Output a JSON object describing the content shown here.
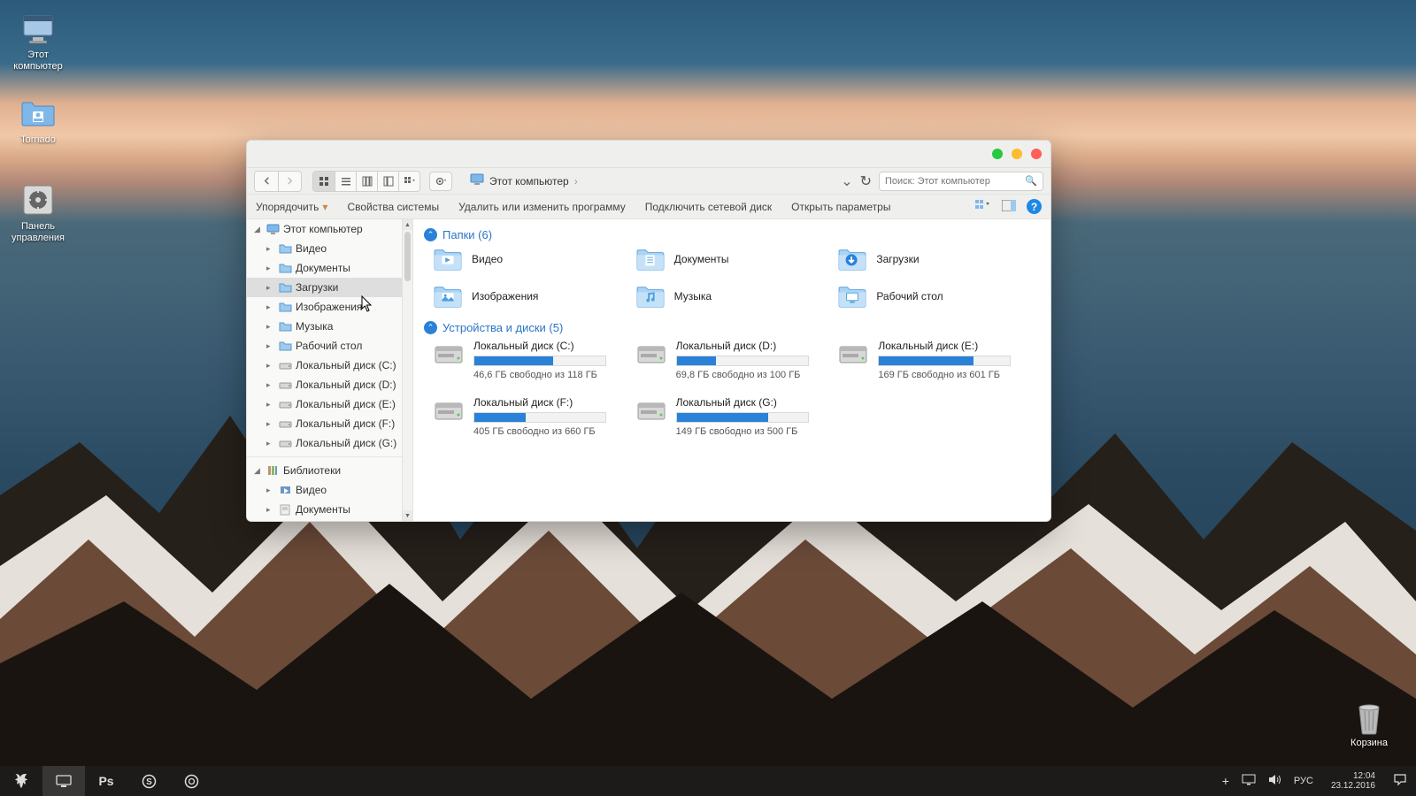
{
  "desktop": {
    "icons": [
      {
        "name": "this-pc",
        "label": "Этот\nкомпьютер"
      },
      {
        "name": "tornado",
        "label": "Tornado"
      },
      {
        "name": "control-panel",
        "label": "Панель\nуправления"
      }
    ],
    "trash_label": "Корзина"
  },
  "taskbar": {
    "lang": "РУС",
    "time": "12:04",
    "date": "23.12.2016"
  },
  "explorer": {
    "breadcrumb": {
      "location": "Этот компьютер"
    },
    "search_placeholder": "Поиск: Этот компьютер",
    "toolbar": {
      "organize": "Упорядочить",
      "system_props": "Свойства системы",
      "uninstall": "Удалить или изменить программу",
      "map_drive": "Подключить сетевой диск",
      "open_settings": "Открыть параметры"
    },
    "sidebar": {
      "root": "Этот компьютер",
      "children": [
        "Видео",
        "Документы",
        "Загрузки",
        "Изображения",
        "Музыка",
        "Рабочий стол",
        "Локальный диск (C:)",
        "Локальный диск (D:)",
        "Локальный диск (E:)",
        "Локальный диск (F:)",
        "Локальный диск (G:)"
      ],
      "libraries_header": "Библиотеки",
      "libraries": [
        "Видео",
        "Документы"
      ]
    },
    "groups": {
      "folders_title": "Папки (6)",
      "drives_title": "Устройства и диски (5)"
    },
    "folders": [
      {
        "label": "Видео",
        "kind": "video"
      },
      {
        "label": "Документы",
        "kind": "docs"
      },
      {
        "label": "Загрузки",
        "kind": "downloads"
      },
      {
        "label": "Изображения",
        "kind": "pictures"
      },
      {
        "label": "Музыка",
        "kind": "music"
      },
      {
        "label": "Рабочий стол",
        "kind": "desktop"
      }
    ],
    "drives": [
      {
        "label": "Локальный диск (C:)",
        "free": "46,6 ГБ свободно из 118 ГБ",
        "used_pct": 60
      },
      {
        "label": "Локальный диск (D:)",
        "free": "69,8 ГБ свободно из 100 ГБ",
        "used_pct": 30
      },
      {
        "label": "Локальный диск (E:)",
        "free": "169 ГБ свободно из 601 ГБ",
        "used_pct": 72
      },
      {
        "label": "Локальный диск (F:)",
        "free": "405 ГБ свободно из 660 ГБ",
        "used_pct": 39
      },
      {
        "label": "Локальный диск (G:)",
        "free": "149 ГБ свободно из 500 ГБ",
        "used_pct": 70
      }
    ]
  }
}
